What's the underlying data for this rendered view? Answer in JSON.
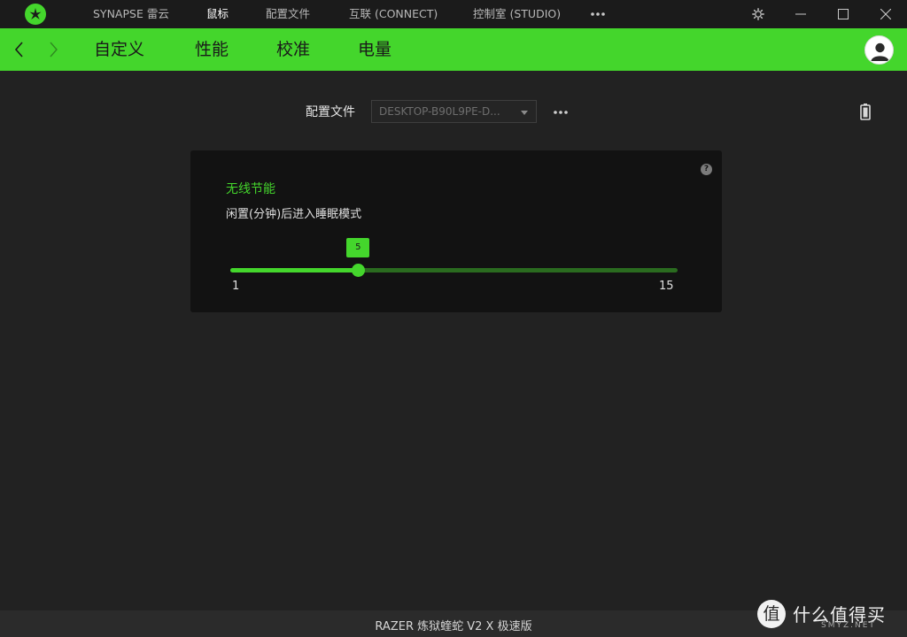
{
  "titlebar": {
    "logo_icon": "razer-logo-icon",
    "nav": [
      {
        "label": "SYNAPSE 雷云",
        "active": false
      },
      {
        "label": "鼠标",
        "active": true
      },
      {
        "label": "配置文件",
        "active": false
      },
      {
        "label": "互联 (CONNECT)",
        "active": false
      },
      {
        "label": "控制室 (STUDIO)",
        "active": false
      }
    ],
    "more_icon": "more-horizontal-icon",
    "window_buttons": [
      "settings-icon",
      "minimize-icon",
      "maximize-icon",
      "close-icon"
    ]
  },
  "subheader": {
    "back_icon": "chevron-left-icon",
    "forward_icon": "chevron-right-icon",
    "tabs": [
      {
        "label": "自定义"
      },
      {
        "label": "性能"
      },
      {
        "label": "校准"
      },
      {
        "label": "电量",
        "active": true
      }
    ],
    "avatar_icon": "user-avatar-icon"
  },
  "profile": {
    "label": "配置文件",
    "selected": "DESKTOP-B90L9PE-D...",
    "more_icon": "more-horizontal-icon",
    "battery_icon": "battery-icon"
  },
  "power_card": {
    "title": "无线节能",
    "description": "闲置(分钟)后进入睡眠模式",
    "help_icon": "help-icon",
    "help_glyph": "?",
    "slider": {
      "min": 1,
      "max": 15,
      "value": 5,
      "min_label": "1",
      "max_label": "15",
      "value_label": "5"
    }
  },
  "footer": {
    "device_name": "RAZER 炼狱蝰蛇 V2 X 极速版"
  },
  "watermark": {
    "glyph": "值",
    "text": "什么值得买",
    "sub": "SMYZ.NET"
  },
  "colors": {
    "accent": "#44d62c",
    "track": "#2a6b1f",
    "background": "#222222",
    "titlebar": "#1b1b1b",
    "card": "#121212"
  }
}
